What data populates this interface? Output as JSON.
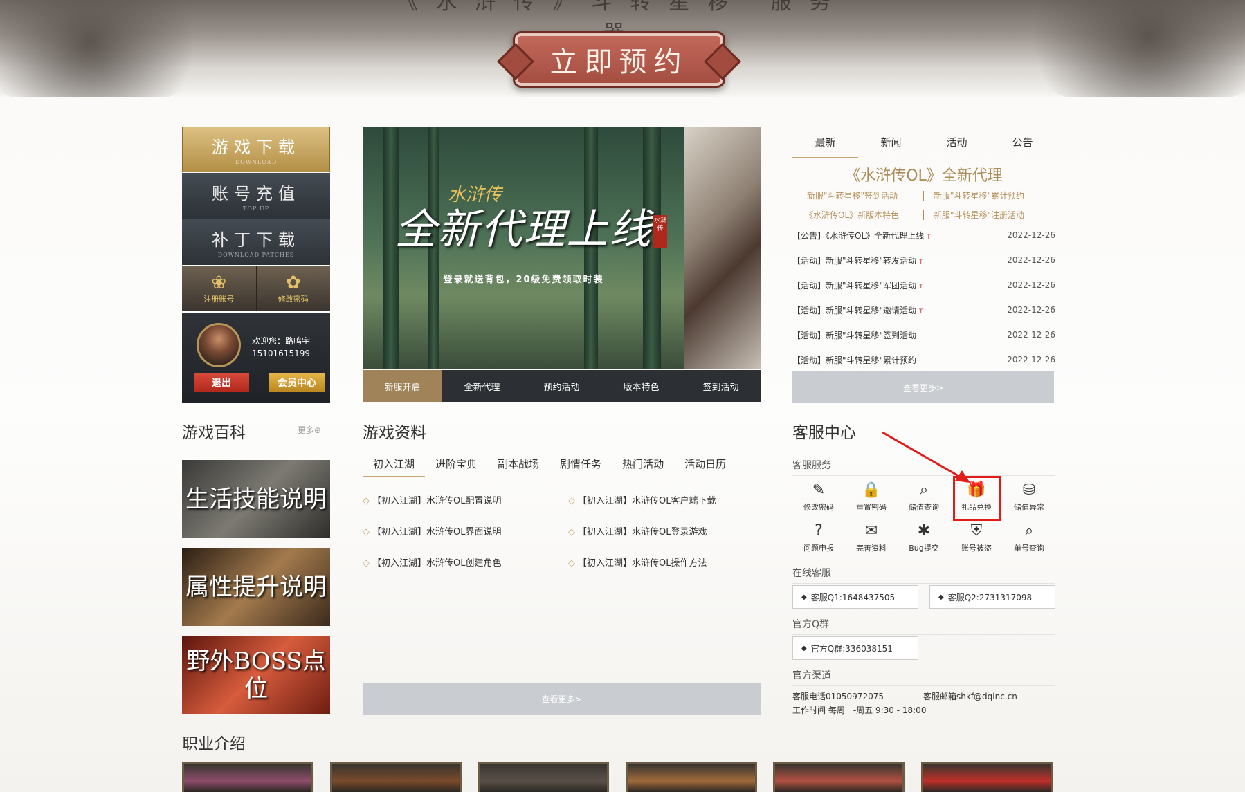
{
  "hero": {
    "slogan": "《水浒传》斗转星移 服务器",
    "reserve_label": "立即预约"
  },
  "left_menu": {
    "download": {
      "label": "游戏下载",
      "sub": "DOWNLOAD"
    },
    "topup": {
      "label": "账号充值",
      "sub": "TOP UP"
    },
    "patch": {
      "label": "补丁下载",
      "sub": "DOWNLOAD PATCHES"
    },
    "register": {
      "label": "注册账号",
      "icon": "register-icon"
    },
    "change_pwd": {
      "label": "修改密码",
      "icon": "password-icon"
    }
  },
  "user": {
    "welcome": "欢迎您：路鸣宇",
    "phone": "15101615199",
    "logout": "退出",
    "member": "会员中心"
  },
  "banner": {
    "logo": "水浒传",
    "title": "全新代理上线",
    "subtitle": "登录就送背包，20级免费领取时装",
    "stamp": "水浒传",
    "tabs": [
      "新服开启",
      "全新代理",
      "预约活动",
      "版本特色",
      "签到活动"
    ]
  },
  "news": {
    "tabs": [
      "最新",
      "新闻",
      "活动",
      "公告"
    ],
    "headline": "《水浒传OL》全新代理",
    "links": [
      "新服\"斗转星移\"签到活动",
      "新服\"斗转星移\"累计预约",
      "《水浒传OL》新版本特色",
      "新服\"斗转星移\"注册活动"
    ],
    "items": [
      {
        "title": "【公告】《水浒传OL》全新代理上线",
        "hot": "T",
        "date": "2022-12-26"
      },
      {
        "title": "【活动】新服\"斗转星移\"转发活动",
        "hot": "T",
        "date": "2022-12-26"
      },
      {
        "title": "【活动】新服\"斗转星移\"军团活动",
        "hot": "T",
        "date": "2022-12-26"
      },
      {
        "title": "【活动】新服\"斗转星移\"邀请活动",
        "hot": "T",
        "date": "2022-12-26"
      },
      {
        "title": "【活动】新服\"斗转星移\"签到活动",
        "hot": "",
        "date": "2022-12-26"
      },
      {
        "title": "【活动】新服\"斗转星移\"累计预约",
        "hot": "",
        "date": "2022-12-26"
      }
    ],
    "more": "查看更多>"
  },
  "wiki": {
    "title": "游戏百科",
    "more": "更多⊕",
    "cards": [
      "生活技能说明",
      "属性提升说明",
      "野外BOSS点位"
    ]
  },
  "info": {
    "title": "游戏资料",
    "tabs": [
      "初入江湖",
      "进阶宝典",
      "副本战场",
      "剧情任务",
      "热门活动",
      "活动日历"
    ],
    "items": [
      "【初入江湖】水浒传OL配置说明",
      "【初入江湖】水浒传OL客户端下载",
      "【初入江湖】水浒传OL界面说明",
      "【初入江湖】水浒传OL登录游戏",
      "【初入江湖】水浒传OL创建角色",
      "【初入江湖】水浒传OL操作方法"
    ],
    "more": "查看更多>"
  },
  "service": {
    "title": "客服中心",
    "sub_service": "客服服务",
    "items": [
      {
        "label": "修改密码",
        "icon": "✎"
      },
      {
        "label": "重置密码",
        "icon": "🔒"
      },
      {
        "label": "储值查询",
        "icon": "⌕"
      },
      {
        "label": "礼品兑换",
        "icon": "🎁"
      },
      {
        "label": "储值异常",
        "icon": "⛁"
      },
      {
        "label": "问题申报",
        "icon": "?"
      },
      {
        "label": "完善资料",
        "icon": "✉"
      },
      {
        "label": "Bug提交",
        "icon": "✱"
      },
      {
        "label": "账号被盗",
        "icon": "⛨"
      },
      {
        "label": "单号查询",
        "icon": "⌕"
      }
    ],
    "sub_online": "在线客服",
    "qq1": "客服Q1:1648437505",
    "qq2": "客服Q2:2731317098",
    "sub_group": "官方Q群",
    "group": "官方Q群:336038151",
    "sub_channel": "官方渠道",
    "phone": "客服电话01050972075",
    "email": "客服邮箱shkf@dqinc.cn",
    "hours": "工作时间 每周一-周五 9:30 - 18:00"
  },
  "jobs": {
    "title": "职业介绍"
  },
  "colors": {
    "gold": "#c8a670",
    "dark": "#2c3034",
    "red_highlight": "#e21b1b"
  }
}
